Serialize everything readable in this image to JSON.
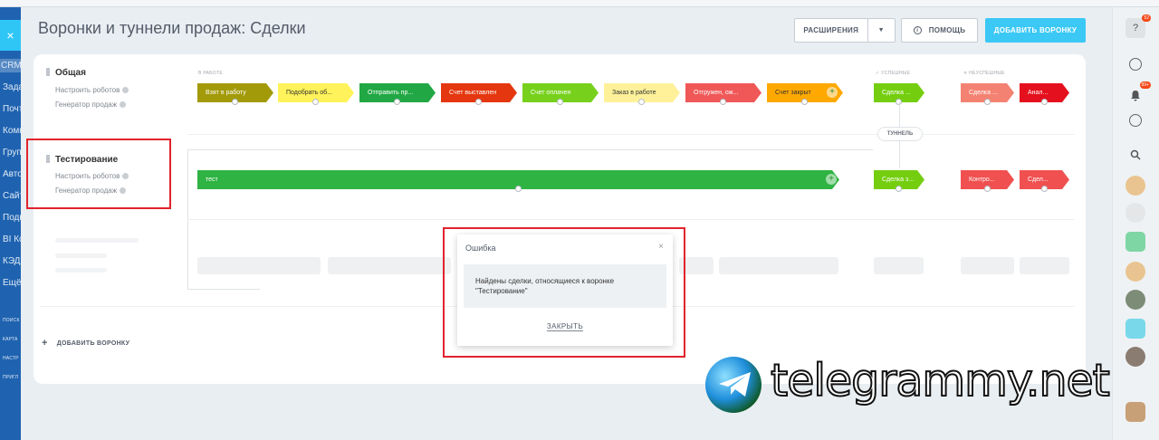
{
  "page_title": "Воронки и туннели продаж: Сделки",
  "toolbar": {
    "extensions_label": "РАСШИРЕНИЯ",
    "help_label": "ПОМОЩЬ",
    "add_funnel_label": "ДОБАВИТЬ ВОРОНКУ"
  },
  "left_nav": {
    "close_icon": "×",
    "items": [
      "CRM",
      "Зада",
      "Почт",
      "Комп",
      "Груп",
      "Авто",
      "Сайт",
      "Подп",
      "BI Ко",
      "КЭДО",
      "Ещё"
    ],
    "small_items": [
      "ПОИСК",
      "КАРТА",
      "НАСТР",
      "ПРИГЛ"
    ]
  },
  "sections": {
    "in_work": "В РАБОТЕ",
    "success": "✓ УСПЕШНЫЕ",
    "fail": "✕ НЕУСПЕШНЫЕ"
  },
  "funnels": [
    {
      "name": "Общая",
      "robots_label": "Настроить роботов",
      "generator_label": "Генератор продаж",
      "stages": [
        {
          "label": "Взят в работу",
          "color": "#a29a09"
        },
        {
          "label": "Подобрать об...",
          "color": "#fff25a"
        },
        {
          "label": "Отправить пр...",
          "color": "#21a844"
        },
        {
          "label": "Счет выставлен",
          "color": "#e5370f"
        },
        {
          "label": "Счет оплачен",
          "color": "#77d11c"
        },
        {
          "label": "Заказ в работе",
          "color": "#fff19a"
        },
        {
          "label": "Отгружен, ож...",
          "color": "#f05858"
        },
        {
          "label": "Счет закрыт",
          "color": "#ffa900"
        }
      ],
      "success_stage": {
        "label": "Сделка ...",
        "color": "#74ce0f"
      },
      "fail_stages": [
        {
          "label": "Сделка ...",
          "color": "#f48272"
        },
        {
          "label": "Анал...",
          "color": "#e5101e"
        }
      ]
    },
    {
      "name": "Тестирование",
      "robots_label": "Настроить роботов",
      "generator_label": "Генератор продаж",
      "stages": [
        {
          "label": "тест",
          "color": "#2fb343"
        }
      ],
      "success_stage": {
        "label": "Сделка з...",
        "color": "#74ce0f"
      },
      "fail_stages": [
        {
          "label": "Контро...",
          "color": "#f05050"
        },
        {
          "label": "Сдел...",
          "color": "#f05050"
        }
      ]
    }
  ],
  "tunnel_label": "ТУННЕЛЬ",
  "add_funnel_bottom": "ДОБАВИТЬ ВОРОНКУ",
  "dialog": {
    "title": "Ошибка",
    "close_icon": "×",
    "message": "Найдены сделки, относящиеся к воронке \"Тестирование\"",
    "button_label": "ЗАКРЫТЬ"
  },
  "right_bar": {
    "help_badge": "52",
    "notify_badge": "99+"
  },
  "watermark": "telegrammy.net"
}
